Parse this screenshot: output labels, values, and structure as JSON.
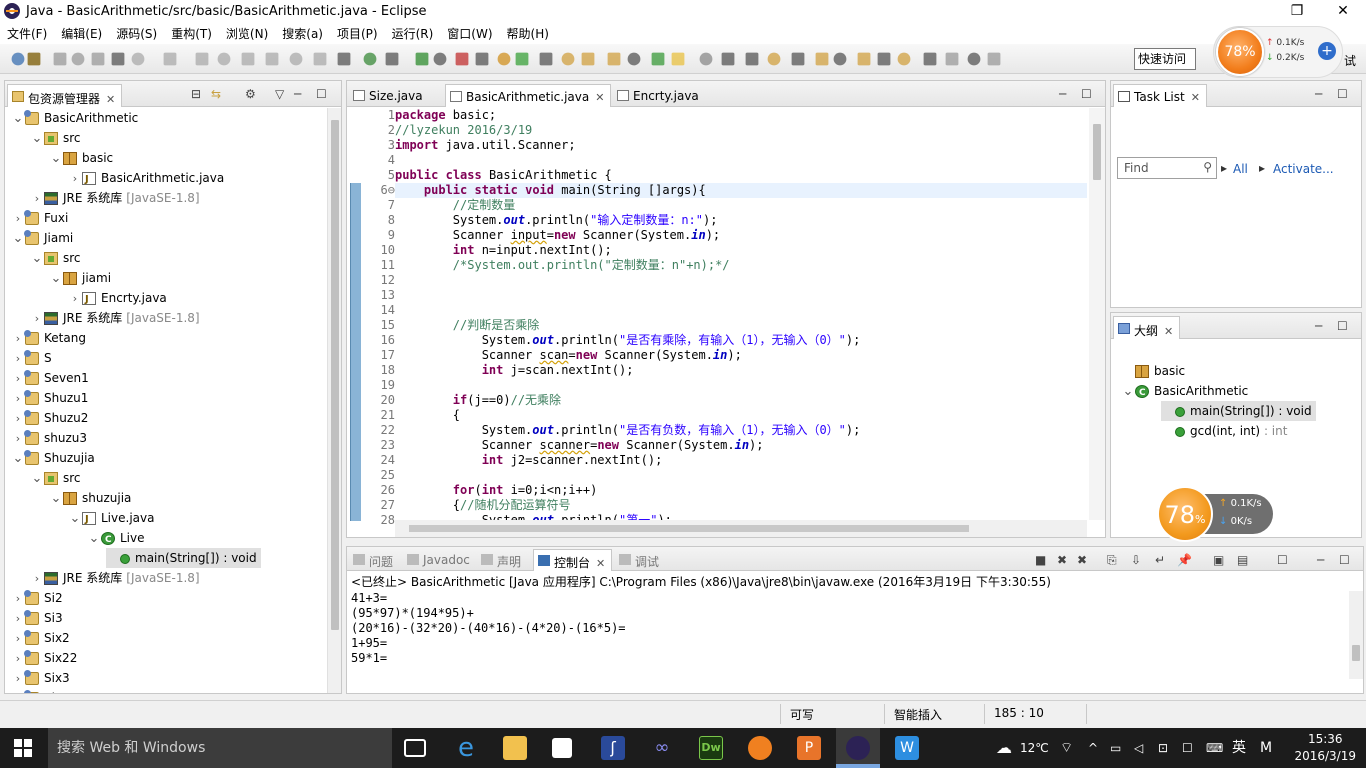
{
  "window": {
    "title": "Java - BasicArithmetic/src/basic/BasicArithmetic.java - Eclipse",
    "restore": "❐",
    "close": "✕"
  },
  "menu": [
    "文件(F)",
    "编辑(E)",
    "源码(S)",
    "重构(T)",
    "浏览(N)",
    "搜索(a)",
    "项目(P)",
    "运行(R)",
    "窗口(W)",
    "帮助(H)"
  ],
  "quick_access": "快速访问",
  "net_widget": {
    "percent": "78%",
    "up": "0.1K/s",
    "down": "0.2K/s",
    "label": "试"
  },
  "package_explorer": {
    "tab": "包资源管理器",
    "items": [
      {
        "label": "BasicArithmetic",
        "icon": "project",
        "depth": 0,
        "arrow": "open"
      },
      {
        "label": "src",
        "icon": "src",
        "depth": 1,
        "arrow": "open"
      },
      {
        "label": "basic",
        "icon": "package",
        "depth": 2,
        "arrow": "open"
      },
      {
        "label": "BasicArithmetic.java",
        "icon": "java",
        "depth": 3,
        "arrow": "closed"
      },
      {
        "label": "JRE 系统库",
        "suffix": "[JavaSE-1.8]",
        "icon": "library",
        "depth": 1,
        "arrow": "closed"
      },
      {
        "label": "Fuxi",
        "icon": "project",
        "depth": 0,
        "arrow": "closed"
      },
      {
        "label": "Jiami",
        "icon": "project",
        "depth": 0,
        "arrow": "open"
      },
      {
        "label": "src",
        "icon": "src",
        "depth": 1,
        "arrow": "open"
      },
      {
        "label": "jiami",
        "icon": "package",
        "depth": 2,
        "arrow": "open"
      },
      {
        "label": "Encrty.java",
        "icon": "java",
        "depth": 3,
        "arrow": "closed"
      },
      {
        "label": "JRE 系统库",
        "suffix": "[JavaSE-1.8]",
        "icon": "library",
        "depth": 1,
        "arrow": "closed"
      },
      {
        "label": "Ketang",
        "icon": "project",
        "depth": 0,
        "arrow": "closed"
      },
      {
        "label": "S",
        "icon": "project",
        "depth": 0,
        "arrow": "closed"
      },
      {
        "label": "Seven1",
        "icon": "project",
        "depth": 0,
        "arrow": "closed"
      },
      {
        "label": "Shuzu1",
        "icon": "project",
        "depth": 0,
        "arrow": "closed"
      },
      {
        "label": "Shuzu2",
        "icon": "project",
        "depth": 0,
        "arrow": "closed"
      },
      {
        "label": "shuzu3",
        "icon": "project",
        "depth": 0,
        "arrow": "closed"
      },
      {
        "label": "Shuzujia",
        "icon": "project",
        "depth": 0,
        "arrow": "open"
      },
      {
        "label": "src",
        "icon": "src",
        "depth": 1,
        "arrow": "open"
      },
      {
        "label": "shuzujia",
        "icon": "package",
        "depth": 2,
        "arrow": "open"
      },
      {
        "label": "Live.java",
        "icon": "java",
        "depth": 3,
        "arrow": "open"
      },
      {
        "label": "Live",
        "icon": "class",
        "depth": 4,
        "arrow": "open"
      },
      {
        "label": "main(String[]) : void",
        "icon": "method",
        "depth": 5,
        "arrow": "none",
        "selected": true
      },
      {
        "label": "JRE 系统库",
        "suffix": "[JavaSE-1.8]",
        "icon": "library",
        "depth": 1,
        "arrow": "closed"
      },
      {
        "label": "Si2",
        "icon": "project",
        "depth": 0,
        "arrow": "closed"
      },
      {
        "label": "Si3",
        "icon": "project",
        "depth": 0,
        "arrow": "closed"
      },
      {
        "label": "Six2",
        "icon": "project",
        "depth": 0,
        "arrow": "closed"
      },
      {
        "label": "Six22",
        "icon": "project",
        "depth": 0,
        "arrow": "closed"
      },
      {
        "label": "Six3",
        "icon": "project",
        "depth": 0,
        "arrow": "closed"
      },
      {
        "label": "SiZe",
        "icon": "project",
        "depth": 0,
        "arrow": "closed"
      }
    ]
  },
  "editor": {
    "tabs": [
      "Size.java",
      "BasicArithmetic.java",
      "Encrty.java"
    ],
    "active_tab": 1,
    "line_numbers": [
      "1",
      "2",
      "3",
      "4",
      "5",
      "6⊖",
      "7",
      "8",
      "9",
      "10",
      "11",
      "12",
      "13",
      "14",
      "15",
      "16",
      "17",
      "18",
      "19",
      "20",
      "21",
      "22",
      "23",
      "24",
      "25",
      "26",
      "27",
      "28"
    ],
    "lines": [
      [
        [
          "kw",
          "package"
        ],
        [
          "t",
          " basic;"
        ]
      ],
      [
        [
          "cm",
          "//lyzekun 2016/3/19"
        ]
      ],
      [
        [
          "kw",
          "import"
        ],
        [
          "t",
          " java.util.Scanner;"
        ]
      ],
      [
        [
          "t",
          ""
        ]
      ],
      [
        [
          "kw",
          "public"
        ],
        [
          "t",
          " "
        ],
        [
          "kw",
          "class"
        ],
        [
          "t",
          " BasicArithmetic {"
        ]
      ],
      [
        [
          "t",
          "    "
        ],
        [
          "kw",
          "public"
        ],
        [
          "t",
          " "
        ],
        [
          "kw",
          "static"
        ],
        [
          "t",
          " "
        ],
        [
          "kw",
          "void"
        ],
        [
          "t",
          " main(String []args){"
        ]
      ],
      [
        [
          "t",
          "        "
        ],
        [
          "cm",
          "//定制数量"
        ]
      ],
      [
        [
          "t",
          "        System."
        ],
        [
          "fld",
          "out"
        ],
        [
          "t",
          ".println("
        ],
        [
          "str",
          "\"输入定制数量：n:\""
        ],
        [
          "t",
          ");"
        ]
      ],
      [
        [
          "t",
          "        Scanner "
        ],
        [
          "warn",
          "input"
        ],
        [
          "t",
          "="
        ],
        [
          "kw",
          "new"
        ],
        [
          "t",
          " Scanner(System."
        ],
        [
          "fld",
          "in"
        ],
        [
          "t",
          ");"
        ]
      ],
      [
        [
          "t",
          "        "
        ],
        [
          "kw",
          "int"
        ],
        [
          "t",
          " n=input.nextInt();"
        ]
      ],
      [
        [
          "t",
          "        "
        ],
        [
          "cm",
          "/*System.out.println(\"定制数量：n\"+n);*/"
        ]
      ],
      [
        [
          "t",
          ""
        ]
      ],
      [
        [
          "t",
          ""
        ]
      ],
      [
        [
          "t",
          ""
        ]
      ],
      [
        [
          "t",
          "        "
        ],
        [
          "cm",
          "//判断是否乘除"
        ]
      ],
      [
        [
          "t",
          "            System."
        ],
        [
          "fld",
          "out"
        ],
        [
          "t",
          ".println("
        ],
        [
          "str",
          "\"是否有乘除，有输入（1），无输入（0）\""
        ],
        [
          "t",
          ");"
        ]
      ],
      [
        [
          "t",
          "            Scanner "
        ],
        [
          "warn",
          "scan"
        ],
        [
          "t",
          "="
        ],
        [
          "kw",
          "new"
        ],
        [
          "t",
          " Scanner(System."
        ],
        [
          "fld",
          "in"
        ],
        [
          "t",
          ");"
        ]
      ],
      [
        [
          "t",
          "            "
        ],
        [
          "kw",
          "int"
        ],
        [
          "t",
          " j=scan.nextInt();"
        ]
      ],
      [
        [
          "t",
          ""
        ]
      ],
      [
        [
          "t",
          "        "
        ],
        [
          "kw",
          "if"
        ],
        [
          "t",
          "(j==0)"
        ],
        [
          "cm",
          "//无乘除"
        ]
      ],
      [
        [
          "t",
          "        {"
        ]
      ],
      [
        [
          "t",
          "            System."
        ],
        [
          "fld",
          "out"
        ],
        [
          "t",
          ".println("
        ],
        [
          "str",
          "\"是否有负数，有输入（1），无输入（0）\""
        ],
        [
          "t",
          ");"
        ]
      ],
      [
        [
          "t",
          "            Scanner "
        ],
        [
          "warn",
          "scanner"
        ],
        [
          "t",
          "="
        ],
        [
          "kw",
          "new"
        ],
        [
          "t",
          " Scanner(System."
        ],
        [
          "fld",
          "in"
        ],
        [
          "t",
          ");"
        ]
      ],
      [
        [
          "t",
          "            "
        ],
        [
          "kw",
          "int"
        ],
        [
          "t",
          " j2=scanner.nextInt();"
        ]
      ],
      [
        [
          "t",
          ""
        ]
      ],
      [
        [
          "t",
          "        "
        ],
        [
          "kw",
          "for"
        ],
        [
          "t",
          "("
        ],
        [
          "kw",
          "int"
        ],
        [
          "t",
          " i=0;i<n;i++)"
        ]
      ],
      [
        [
          "t",
          "        {"
        ],
        [
          "cm",
          "//随机分配运算符号"
        ]
      ],
      [
        [
          "t",
          "            System."
        ],
        [
          "fld",
          "out"
        ],
        [
          "t",
          ".println("
        ],
        [
          "str",
          "\"第一\""
        ],
        [
          "t",
          ");"
        ]
      ]
    ]
  },
  "task_list": {
    "tab": "Task List",
    "find_placeholder": "Find",
    "all": "All",
    "activate": "Activate..."
  },
  "outline": {
    "tab": "大纲",
    "items": [
      {
        "label": "basic",
        "icon": "package",
        "depth": 0
      },
      {
        "label": "BasicArithmetic",
        "icon": "class",
        "depth": 0,
        "arrow": "open"
      },
      {
        "label": "main(String[]) : void",
        "icon": "method",
        "depth": 1,
        "selected": true
      },
      {
        "label": "gcd(int, int)",
        "suffix": " : int",
        "icon": "method",
        "depth": 1
      }
    ]
  },
  "float_ball": {
    "percent": "78",
    "unit": "%",
    "up": "0.1K/s",
    "down": "0K/s"
  },
  "console": {
    "tabs": [
      "问题",
      "Javadoc",
      "声明",
      "控制台",
      "调试"
    ],
    "active_tab": 3,
    "header": "<已终止> BasicArithmetic [Java 应用程序] C:\\Program Files (x86)\\Java\\jre8\\bin\\javaw.exe (2016年3月19日 下午3:30:55)",
    "output": [
      "41+3=",
      "(95*97)*(194*95)+",
      "(20*16)-(32*20)-(40*16)-(4*20)-(16*5)=",
      "1+95=",
      "59*1="
    ]
  },
  "status": {
    "writable": "可写",
    "insert_mode": "智能插入",
    "position": "185 : 10"
  },
  "taskbar": {
    "search_placeholder": "搜索 Web 和 Windows",
    "temperature": "12℃",
    "ime": "英",
    "ime2": "M",
    "time": "15:36",
    "date": "2016/3/19"
  }
}
